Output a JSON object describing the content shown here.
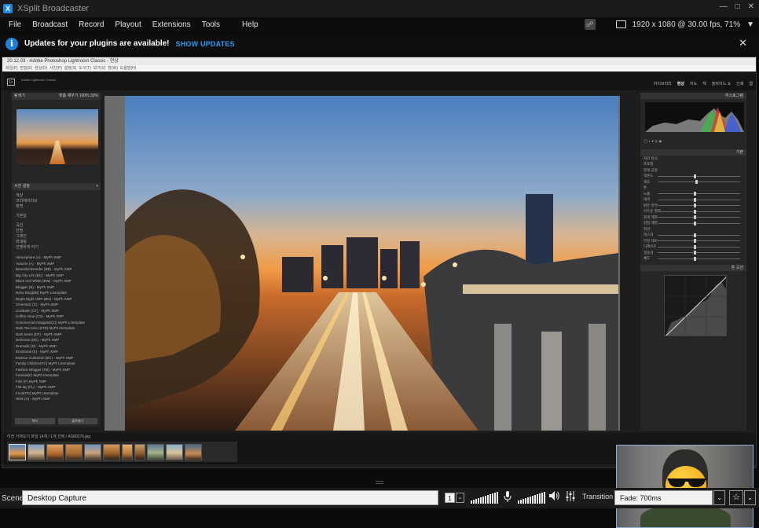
{
  "window": {
    "title": "XSplit Broadcaster"
  },
  "menu": {
    "items": [
      "File",
      "Broadcast",
      "Record",
      "Playout",
      "Extensions",
      "Tools",
      "Help"
    ],
    "resolution": "1920 x 1080 @ 30.00 fps, 71%"
  },
  "banner": {
    "message": "Updates for your plugins are available!",
    "link": "SHOW UPDATES"
  },
  "lightroom": {
    "window_title": "20.12.03 - Adobe Photoshop Lightroom Classic - 현상",
    "catalog": "Adobe Lightroom Classic",
    "modules": [
      "라이브러리",
      "현상",
      "지도",
      "책",
      "슬라이드 쇼",
      "인쇄",
      "웹"
    ],
    "active_module": "현상",
    "navigator_header": "탐색기",
    "presets_header": "사전 설정",
    "preset_sections": [
      "색상",
      "크리에이티브",
      "흑백",
      "기본값",
      "곡선",
      "선명",
      "그레인",
      "비네팅",
      "선명하게 하기"
    ],
    "preset_items": [
      "Atmosphere (A) - MyPh XMP",
      "Autumn (A) - MyPh XMP",
      "Beautiful Breeder (BB) - MyPh XMP",
      "Big City Life (BC) - MyPh XMP",
      "Black And White (BW) - MyPh XMP",
      "Blogger (B) - MyPh XMP",
      "Boho Blog(BB) MyPh Lrtemplate",
      "Bright Night HDR (BN) - MyPh XMP",
      "Cinematic (C) - MyPh XMP",
      "Cocktails (CT) - MyPh XMP",
      "Coffee shop (CS) - MyPh XMP",
      "Commercial Instagram(CI) MyPh Lrtemplate",
      "Dark Tea tone (DTD) MyPh lrtemplate",
      "Dark tones (DT) - MyPh XMP",
      "Delicious (DE) - MyPh XMP",
      "Dramatic (D) - MyPh XMP",
      "Emotional (E) - MyPh XMP",
      "Exterior Collection (EC) - MyPh XMP",
      "Family Children(FC) MyPh Lrtemplate",
      "Fashion Blogger (FB) - MyPh XMP",
      "Festival(F) MyPh lrtemplate",
      "Film (F) MyPh XMP",
      "Flat lay (FL) - MyPh XMP",
      "Food(FD) MyPh Lrtemplate",
      "HDR (H) - MyPh XMP"
    ],
    "left_buttons": [
      "복사",
      "붙여넣기"
    ],
    "histogram_header": "히스토그램",
    "basic_header": "기본",
    "basic_rows": [
      "처리 방식",
      "프로필",
      "흰색 균형",
      "색온도",
      "색조",
      "톤",
      "노출",
      "대비",
      "밝은 영역",
      "어두운 영역",
      "흰색 계열",
      "검정 계열",
      "외관",
      "텍스처",
      "부분 대비",
      "디헤이즈",
      "생동감",
      "채도"
    ],
    "tone_curve_header": "톤 곡선",
    "filmstrip_path": "이전 가져오기  파일 14개 / 1개 선택 / AS80376.jpg"
  },
  "statusbar": {
    "scene_label": "Scene",
    "scene_name": "Desktop Capture",
    "scene_number": "1",
    "transition_label": "Transition",
    "transition_value": "Fade: 700ms"
  },
  "icons": {
    "app": "xsplit-logo-icon",
    "info": "info-icon",
    "close": "close-icon",
    "monitor": "monitor-icon",
    "mic": "microphone-icon",
    "speaker": "speaker-icon",
    "mixer": "mixer-icon",
    "star": "star-icon",
    "chevron": "chevron-down-icon"
  },
  "colors": {
    "accent": "#2b9bf4",
    "info_blue": "#1f7ed8"
  }
}
